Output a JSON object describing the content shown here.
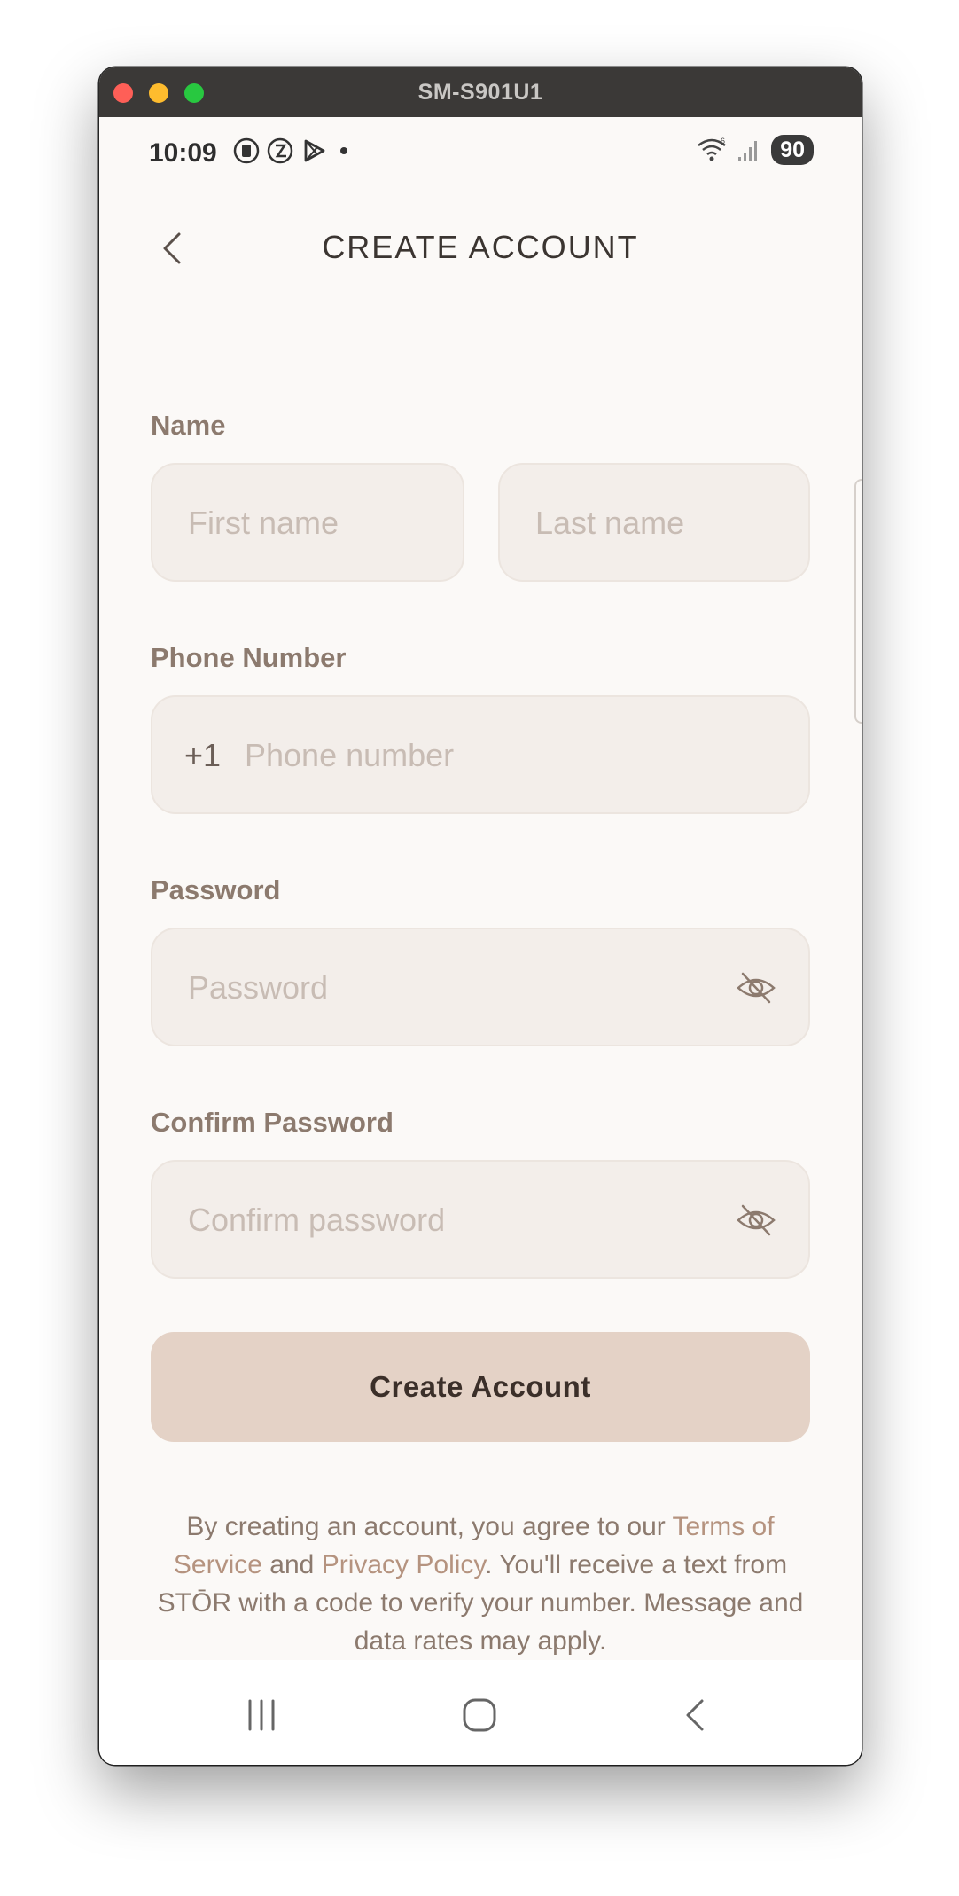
{
  "window": {
    "title": "SM-S901U1"
  },
  "status_bar": {
    "time": "10:09",
    "battery": "90",
    "left_icons": [
      "sim-icon",
      "data-saver-icon",
      "play-store-icon",
      "dot-icon"
    ],
    "right_icons": [
      "wifi-icon",
      "signal-icon"
    ]
  },
  "header": {
    "title": "CREATE ACCOUNT"
  },
  "form": {
    "name_label": "Name",
    "first_name_placeholder": "First name",
    "last_name_placeholder": "Last name",
    "phone_label": "Phone Number",
    "phone_prefix": "+1",
    "phone_placeholder": "Phone number",
    "password_label": "Password",
    "password_placeholder": "Password",
    "confirm_label": "Confirm Password",
    "confirm_placeholder": "Confirm password",
    "submit_label": "Create Account"
  },
  "legal": {
    "text_1": "By creating an account, you agree to our ",
    "terms_link": "Terms of Service",
    "text_2": " and ",
    "privacy_link": "Privacy Policy",
    "text_3": ". You'll receive a text from STŌR with a code to verify your number. Message and data rates may apply."
  },
  "colors": {
    "accent": "#e4d2c6",
    "label": "#8c7a6e",
    "link": "#b5937f",
    "field_bg": "#f3eeea",
    "page_bg": "#fbf9f7"
  }
}
